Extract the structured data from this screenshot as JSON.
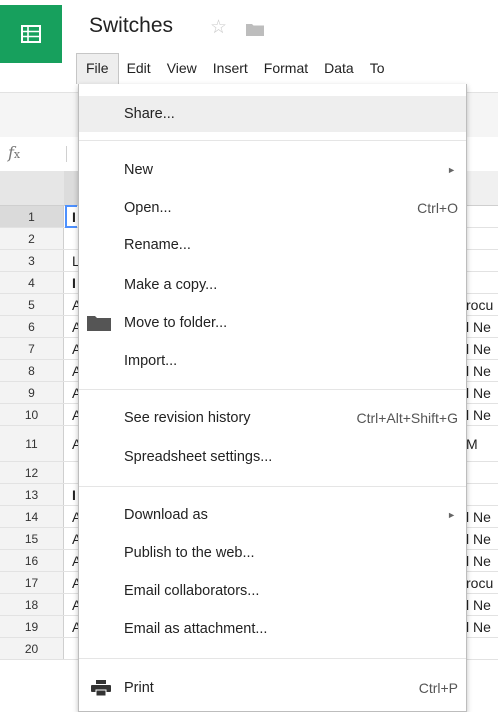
{
  "app": {
    "doc_title": "Switches",
    "brand_color": "#17a05d"
  },
  "menubar": {
    "items": [
      "File",
      "Edit",
      "View",
      "Insert",
      "Format",
      "Data",
      "To"
    ]
  },
  "formula_bar": {
    "fx": "fx"
  },
  "grid": {
    "rows": [
      {
        "n": "1",
        "a": "I",
        "r": ""
      },
      {
        "n": "2",
        "a": "",
        "r": ""
      },
      {
        "n": "3",
        "a": "L",
        "r": ""
      },
      {
        "n": "4",
        "a": "I",
        "r": ""
      },
      {
        "n": "5",
        "a": "A",
        "r": "rocu"
      },
      {
        "n": "6",
        "a": "A",
        "r": "l Ne"
      },
      {
        "n": "7",
        "a": "A",
        "r": "l Ne"
      },
      {
        "n": "8",
        "a": "A",
        "r": "l Ne"
      },
      {
        "n": "9",
        "a": "A",
        "r": "l Ne"
      },
      {
        "n": "10",
        "a": "A",
        "r": "l Ne"
      },
      {
        "n": "11",
        "a": "A",
        "r": "M"
      },
      {
        "n": "12",
        "a": "",
        "r": ""
      },
      {
        "n": "13",
        "a": "I",
        "r": ""
      },
      {
        "n": "14",
        "a": "A",
        "r": "l Ne"
      },
      {
        "n": "15",
        "a": "A",
        "r": "l Ne"
      },
      {
        "n": "16",
        "a": "A",
        "r": "l Ne"
      },
      {
        "n": "17",
        "a": "A",
        "r": "rocu"
      },
      {
        "n": "18",
        "a": "A",
        "r": "l Ne"
      },
      {
        "n": "19",
        "a": "A",
        "r": "l Ne"
      },
      {
        "n": "20",
        "a": "",
        "r": ""
      }
    ]
  },
  "file_menu": {
    "share": "Share...",
    "new": "New",
    "open": "Open...",
    "open_shortcut": "Ctrl+O",
    "rename": "Rename...",
    "make_copy": "Make a copy...",
    "move_to_folder": "Move to folder...",
    "import": "Import...",
    "revision_history": "See revision history",
    "revision_shortcut": "Ctrl+Alt+Shift+G",
    "spreadsheet_settings": "Spreadsheet settings...",
    "download_as": "Download as",
    "publish": "Publish to the web...",
    "email_collaborators": "Email collaborators...",
    "email_attachment": "Email as attachment...",
    "print": "Print",
    "print_shortcut": "Ctrl+P",
    "submenu_arrow": "►"
  }
}
